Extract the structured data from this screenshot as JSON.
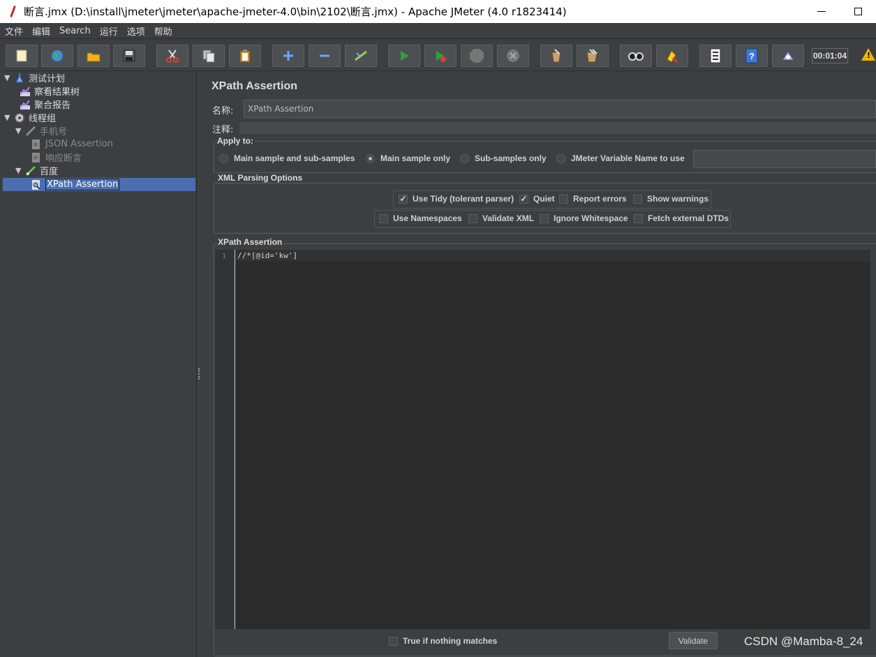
{
  "window": {
    "title": "断言.jmx (D:\\install\\jmeter\\jmeter\\apache-jmeter-4.0\\bin\\2102\\断言.jmx) - Apache JMeter (4.0 r1823414)"
  },
  "menu": {
    "items": [
      "文件",
      "编辑",
      "Search",
      "运行",
      "选项",
      "帮助"
    ]
  },
  "toolbar": {
    "timer": "00:01:04",
    "warning": "!",
    "buttons": [
      {
        "name": "new-icon",
        "color": "#f5f0c8"
      },
      {
        "name": "templates-icon",
        "color": "#4caf50"
      },
      {
        "name": "open-icon",
        "color": "#f2b01e"
      },
      {
        "name": "save-icon",
        "color": "#a0a0a0"
      },
      {
        "name": "cut-icon",
        "color": "#e53935"
      },
      {
        "name": "copy-icon",
        "color": "#d0d0d0"
      },
      {
        "name": "paste-icon",
        "color": "#f2b01e"
      },
      {
        "name": "expand-icon",
        "color": "#6aa6ff"
      },
      {
        "name": "collapse-icon",
        "color": "#6aa6ff"
      },
      {
        "name": "toggle-icon",
        "color": "#7fbf4f"
      },
      {
        "name": "start-icon",
        "color": "#2ea043"
      },
      {
        "name": "start-no-pause-icon",
        "color": "#2ea043"
      },
      {
        "name": "stop-icon",
        "color": "#888888"
      },
      {
        "name": "shutdown-icon",
        "color": "#888888"
      },
      {
        "name": "clear-icon",
        "color": "#c8a070"
      },
      {
        "name": "clear-all-icon",
        "color": "#c8a070"
      },
      {
        "name": "search-icon",
        "color": "#d0d0d0"
      },
      {
        "name": "reset-search-icon",
        "color": "#f2d01e"
      },
      {
        "name": "function-helper-icon",
        "color": "#e0e0e0"
      },
      {
        "name": "help-icon",
        "color": "#3b78d8"
      },
      {
        "name": "remote-icon",
        "color": "#a0b4ff"
      }
    ]
  },
  "tree": {
    "nodes": [
      {
        "label": "测试计划",
        "toggle": "▼",
        "icon": "test-plan-icon",
        "color": "#7aa7ff",
        "disabled": false
      },
      {
        "label": "察看结果树",
        "toggle": "",
        "icon": "results-tree-icon",
        "color": "#b08ae0",
        "disabled": false
      },
      {
        "label": "聚合报告",
        "toggle": "",
        "icon": "aggregate-report-icon",
        "color": "#b08ae0",
        "disabled": false
      },
      {
        "label": "线程组",
        "toggle": "▼",
        "icon": "thread-group-icon",
        "color": "#c8c8c8",
        "disabled": false
      },
      {
        "label": "手机号",
        "toggle": "▼",
        "icon": "sampler-icon",
        "color": "#8a8a8a",
        "disabled": true
      },
      {
        "label": "JSON Assertion",
        "toggle": "",
        "icon": "assertion-icon",
        "color": "#8a8a8a",
        "disabled": true
      },
      {
        "label": "响应断言",
        "toggle": "",
        "icon": "assertion-icon",
        "color": "#8a8a8a",
        "disabled": true
      },
      {
        "label": "百度",
        "toggle": "▼",
        "icon": "sampler-icon",
        "color": "#6abf4b",
        "disabled": false
      },
      {
        "label": "XPath Assertion",
        "toggle": "",
        "icon": "xpath-assertion-icon",
        "color": "#e0e0e0",
        "disabled": false,
        "selected": true
      }
    ]
  },
  "main": {
    "title": "XPath Assertion",
    "name_label": "名称:",
    "name_value": "XPath Assertion",
    "comment_label": "注释:",
    "apply_to": {
      "title": "Apply to:",
      "options": [
        {
          "label": "Main sample and sub-samples",
          "checked": false
        },
        {
          "label": "Main sample only",
          "checked": true
        },
        {
          "label": "Sub-samples only",
          "checked": false
        },
        {
          "label": "JMeter Variable Name to use",
          "checked": false
        }
      ]
    },
    "xml_options": {
      "title": "XML Parsing Options",
      "row1": [
        {
          "label": "Use Tidy (tolerant parser)",
          "checked": true
        },
        {
          "label": "Quiet",
          "checked": true
        },
        {
          "label": "Report errors",
          "checked": false
        },
        {
          "label": "Show warnings",
          "checked": false
        }
      ],
      "row2": [
        {
          "label": "Use Namespaces",
          "checked": false
        },
        {
          "label": "Validate XML",
          "checked": false
        },
        {
          "label": "Ignore Whitespace",
          "checked": false
        },
        {
          "label": "Fetch external DTDs",
          "checked": false
        }
      ]
    },
    "xpath": {
      "title": "XPath Assertion",
      "line_number": "1",
      "expression": "//*[@id='kw']"
    },
    "true_if_nothing_matches": {
      "label": "True if nothing matches",
      "checked": false
    },
    "validate_label": "Validate",
    "watermark": "CSDN @Mamba-8_24"
  }
}
